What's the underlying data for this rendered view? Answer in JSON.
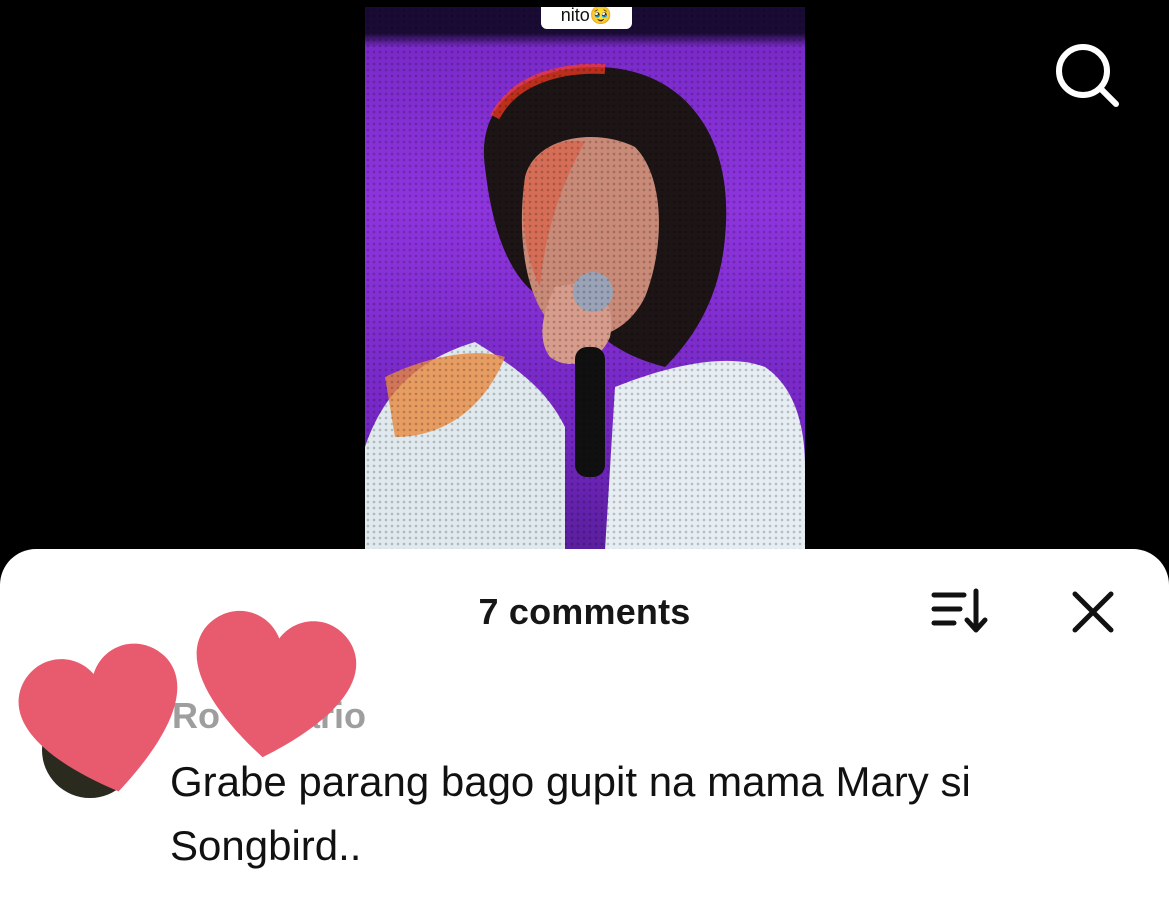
{
  "video": {
    "caption_chip": "nito🥹"
  },
  "icons": {
    "search": "search-icon",
    "sort": "sort-icon",
    "close": "close-icon",
    "heart_sticker": "heart-icon",
    "like": "heart-outline-icon"
  },
  "comments_sheet": {
    "title": "7 comments",
    "comments": [
      {
        "author": "Ro        ario",
        "text": "Grabe parang bago gupit na mama Mary si Songbird.."
      }
    ]
  },
  "colors": {
    "sheet_bg": "#ffffff",
    "video_bg": "#8e35de",
    "heart": "#e85a6e",
    "author_text": "#9e9e9e"
  }
}
